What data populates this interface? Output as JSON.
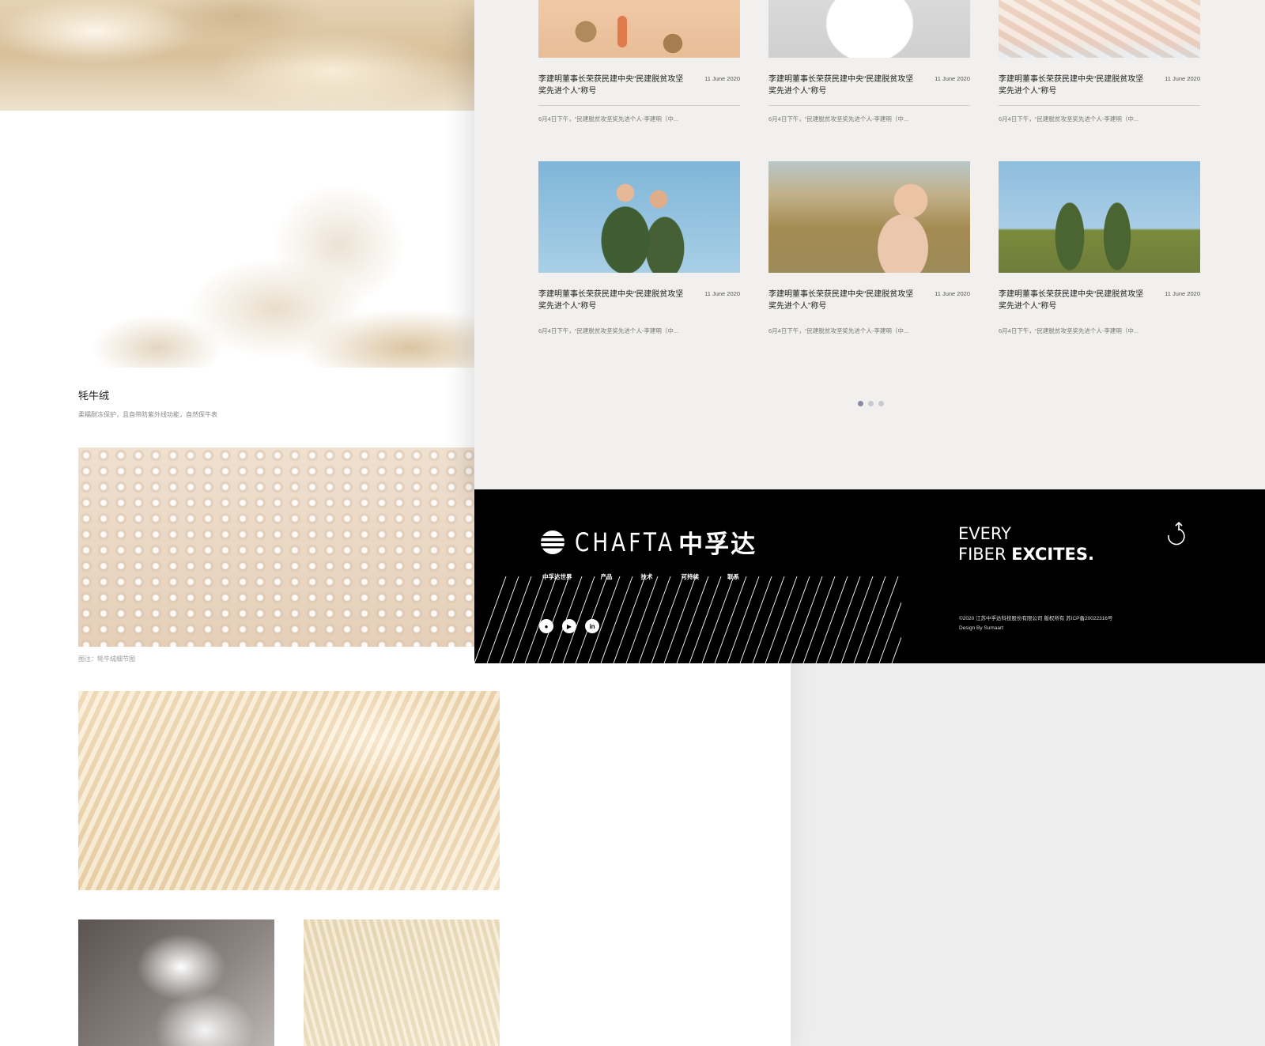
{
  "left_page": {
    "fiber_title": "牦牛绒",
    "fiber_desc": "柔糯耐冻保护，且自带防紫外线功能，自然保牛表",
    "caption": "图注：牦牛绒细节图"
  },
  "news": {
    "cards": [
      {
        "title": "李建明董事长荣获民建中央“民建脱贫攻坚奖先进个人”称号",
        "date": "11 June 2020",
        "excerpt": "6月4日下午，“民建脱贫攻坚奖先进个人-李建明（中..."
      },
      {
        "title": "李建明董事长荣获民建中央“民建脱贫攻坚奖先进个人”称号",
        "date": "11 June 2020",
        "excerpt": "6月4日下午，“民建脱贫攻坚奖先进个人-李建明（中..."
      },
      {
        "title": "李建明董事长荣获民建中央“民建脱贫攻坚奖先进个人”称号",
        "date": "11 June 2020",
        "excerpt": "6月4日下午，“民建脱贫攻坚奖先进个人-李建明（中..."
      },
      {
        "title": "李建明董事长荣获民建中央“民建脱贫攻坚奖先进个人”称号",
        "date": "11 June 2020",
        "excerpt": "6月4日下午，“民建脱贫攻坚奖先进个人-李建明（中..."
      },
      {
        "title": "李建明董事长荣获民建中央“民建脱贫攻坚奖先进个人”称号",
        "date": "11 June 2020",
        "excerpt": "6月4日下午，“民建脱贫攻坚奖先进个人-李建明（中..."
      },
      {
        "title": "李建明董事长荣获民建中央“民建脱贫攻坚奖先进个人”称号",
        "date": "11 June 2020",
        "excerpt": "6月4日下午，“民建脱贫攻坚奖先进个人-李建明（中..."
      }
    ],
    "pagination": {
      "total": 3,
      "active": 1
    }
  },
  "footer": {
    "logo_text": "CHAFTA",
    "logo_cn": "中孚达",
    "nav": [
      "中孚达世界",
      "产品",
      "技术",
      "可持续",
      "联系"
    ],
    "social": [
      {
        "icon": "wechat-icon",
        "glyph": "●"
      },
      {
        "icon": "video-icon",
        "glyph": "▶"
      },
      {
        "icon": "linkedin-icon",
        "glyph": "in"
      }
    ],
    "tagline_line1": "EVERY",
    "tagline_line2_a": "FIBER ",
    "tagline_line2_b": "EXCITES.",
    "copyright": "©2020 江苏中孚达科技股份有限公司 版权所有 苏ICP备20022316号",
    "credit": "Design By Sumaart"
  },
  "colors": {
    "accent_dot": "#8a8aa6",
    "footer_bg": "#000000",
    "page_bg": "#f1f0ee"
  }
}
